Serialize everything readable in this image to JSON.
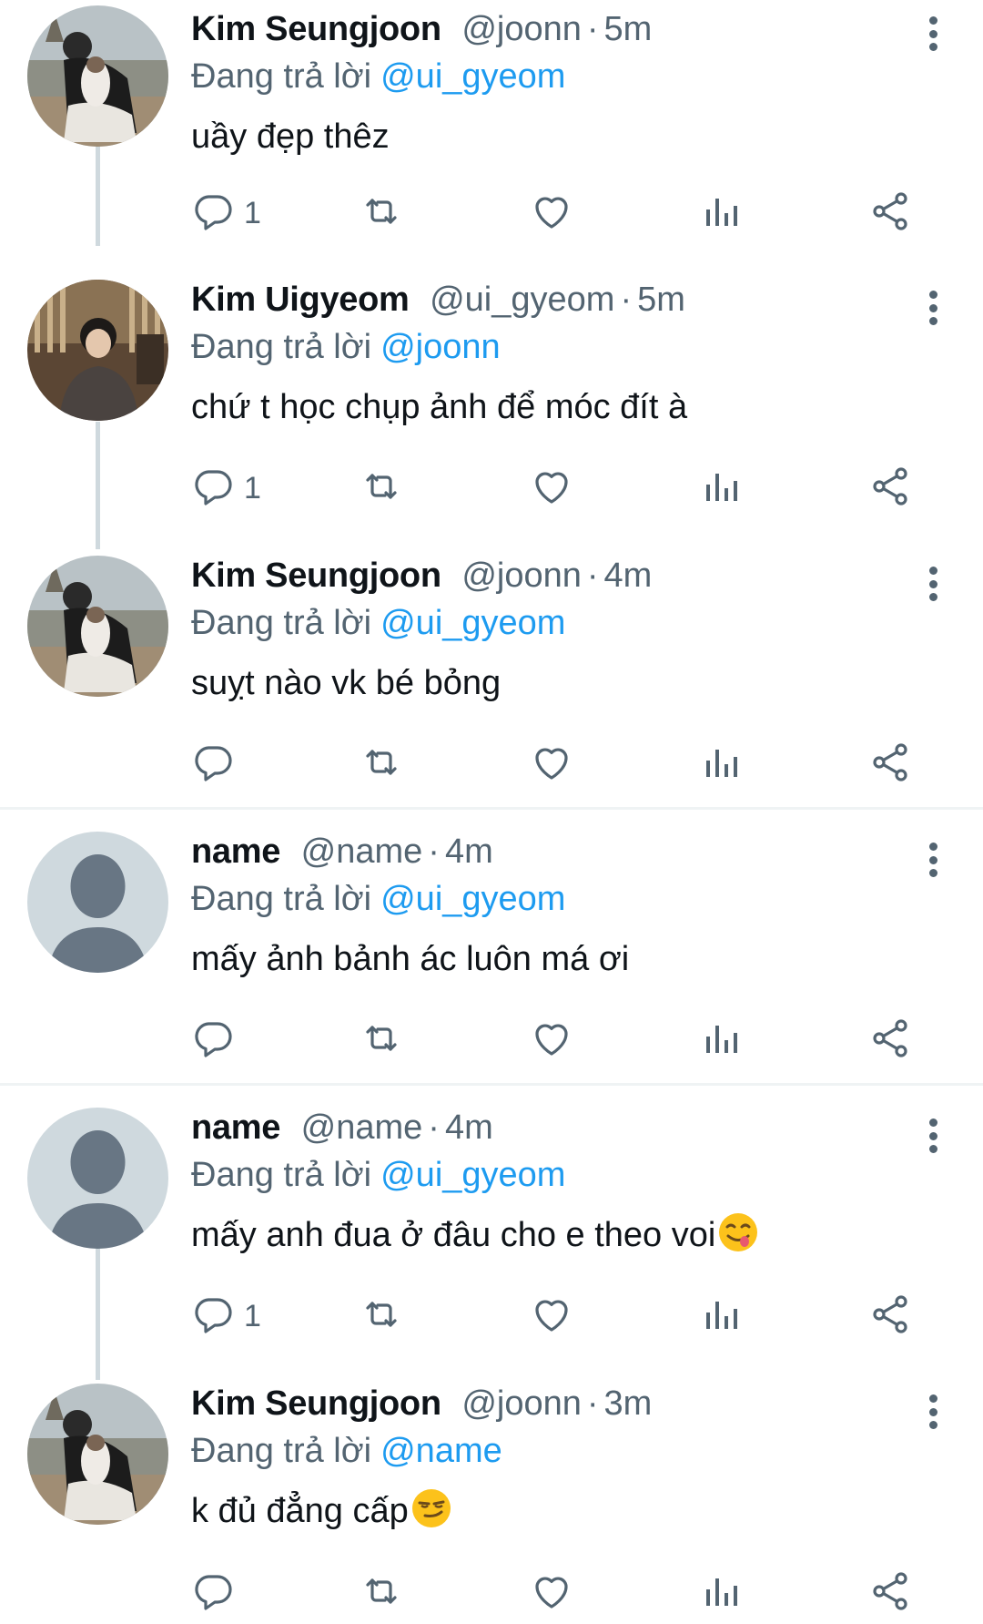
{
  "tweets": [
    {
      "author_name": "Kim Seungjoon",
      "handle": "@joonn",
      "time": "5m",
      "replying_label": "Đang trả lời",
      "replying_to": "@ui_gyeom",
      "text": "uầy đẹp thêz",
      "reply_count": "1",
      "avatar": "person-with-cat-photo"
    },
    {
      "author_name": "Kim Uigyeom",
      "handle": "@ui_gyeom",
      "time": "5m",
      "replying_label": "Đang trả lời",
      "replying_to": "@joonn",
      "text": "chứ t học chụp ảnh để móc đít à",
      "reply_count": "1",
      "avatar": "person-indoor-photo"
    },
    {
      "author_name": "Kim Seungjoon",
      "handle": "@joonn",
      "time": "4m",
      "replying_label": "Đang trả lời",
      "replying_to": "@ui_gyeom",
      "text": "suỵt nào vk bé bỏng",
      "reply_count": "",
      "avatar": "person-with-cat-photo"
    },
    {
      "author_name": "name",
      "handle": "@name",
      "time": "4m",
      "replying_label": "Đang trả lời",
      "replying_to": "@ui_gyeom",
      "text": "mấy ảnh bảnh ác luôn má ơi",
      "reply_count": "",
      "avatar": "default-avatar"
    },
    {
      "author_name": "name",
      "handle": "@name",
      "time": "4m",
      "replying_label": "Đang trả lời",
      "replying_to": "@ui_gyeom",
      "text": "mấy anh đua ở đâu cho e theo voi",
      "emoji": "yum-face-emoji",
      "reply_count": "1",
      "avatar": "default-avatar"
    },
    {
      "author_name": "Kim Seungjoon",
      "handle": "@joonn",
      "time": "3m",
      "replying_label": "Đang trả lời",
      "replying_to": "@name",
      "text": "k đủ đẳng cấp",
      "emoji": "smirk-face-emoji",
      "reply_count": "",
      "avatar": "person-with-cat-photo"
    }
  ],
  "colors": {
    "text": "#0f1419",
    "muted": "#536471",
    "link": "#1d9bf0",
    "thread_line": "#cfd9de",
    "separator": "#eff3f4",
    "default_avatar_bg": "#cfd9de",
    "default_avatar_fg": "#687684"
  }
}
